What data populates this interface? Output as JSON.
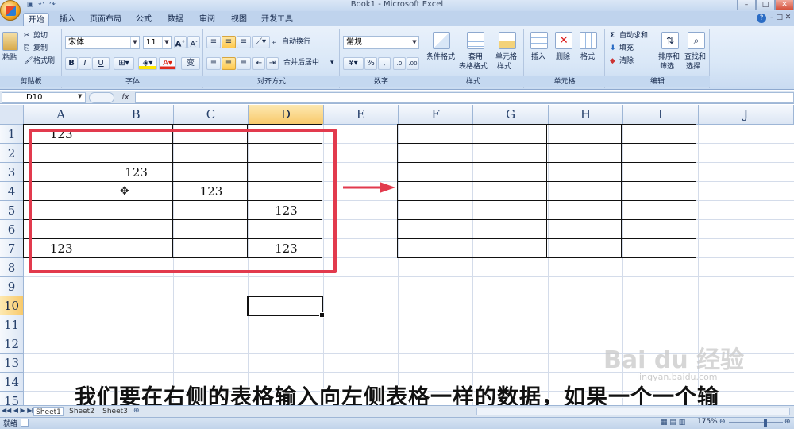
{
  "window": {
    "title": "Book1 - Microsoft Excel"
  },
  "tabs": [
    "开始",
    "插入",
    "页面布局",
    "公式",
    "数据",
    "审阅",
    "视图",
    "开发工具"
  ],
  "ribbon": {
    "clipboard": {
      "paste": "粘贴",
      "cut": "剪切",
      "copy": "复制",
      "format_painter": "格式刷",
      "label": "剪贴板"
    },
    "font": {
      "name": "宋体",
      "size": "11",
      "bold": "B",
      "italic": "I",
      "underline": "U",
      "label": "字体",
      "wen": "变"
    },
    "alignment": {
      "wrap": "自动换行",
      "merge": "合并后居中",
      "label": "对齐方式"
    },
    "number": {
      "format": "常规",
      "percent": "%",
      "label": "数字"
    },
    "styles": {
      "conditional": "条件格式",
      "table_line1": "套用",
      "table_line2": "表格格式",
      "cell_line1": "单元格",
      "cell_line2": "样式",
      "label": "样式"
    },
    "cells": {
      "insert": "插入",
      "delete": "删除",
      "format": "格式",
      "label": "单元格"
    },
    "editing": {
      "autosum": "自动求和",
      "fill": "填充",
      "clear": "清除",
      "sort_line1": "排序和",
      "sort_line2": "筛选",
      "find_line1": "查找和",
      "find_line2": "选择",
      "label": "编辑"
    }
  },
  "formula_bar": {
    "name_box": "D10",
    "fx": "fx",
    "value": ""
  },
  "columns": [
    "A",
    "B",
    "C",
    "D",
    "E",
    "F",
    "G",
    "H",
    "I",
    "J"
  ],
  "rows": [
    "1",
    "2",
    "3",
    "4",
    "5",
    "6",
    "7",
    "8",
    "9",
    "10",
    "11",
    "12",
    "13",
    "14",
    "15"
  ],
  "cells": [
    {
      "ref": "A1",
      "value": "123"
    },
    {
      "ref": "B3",
      "value": "123"
    },
    {
      "ref": "C4",
      "value": "123"
    },
    {
      "ref": "D5",
      "value": "123"
    },
    {
      "ref": "A7",
      "value": "123"
    },
    {
      "ref": "D7",
      "value": "123"
    }
  ],
  "active_cell": "D10",
  "sheets": [
    "Sheet1",
    "Sheet2",
    "Sheet3"
  ],
  "status": {
    "ready": "就绪",
    "zoom": "175%"
  },
  "caption": "我们要在右侧的表格输入向左侧表格一样的数据，如果一个一个输",
  "watermark": {
    "main": "Bai du 经验",
    "sub": "jingyan.baidu.com"
  },
  "colors": {
    "annotation_red": "#e23a4d",
    "ribbon_blue": "#dbe7f6"
  }
}
